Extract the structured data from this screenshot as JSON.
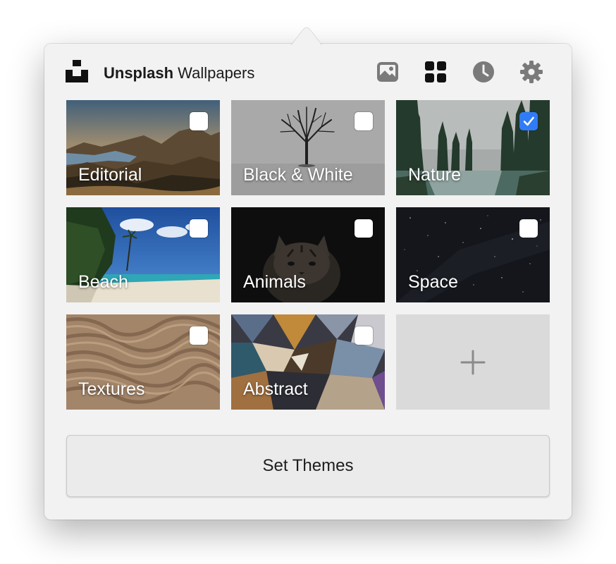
{
  "header": {
    "brand": "Unsplash",
    "title_suffix": " Wallpapers",
    "icons": [
      "image-icon",
      "grid-icon",
      "clock-icon",
      "gear-icon"
    ]
  },
  "categories": [
    {
      "label": "Editorial",
      "checked": false
    },
    {
      "label": "Black & White",
      "checked": false
    },
    {
      "label": "Nature",
      "checked": true
    },
    {
      "label": "Beach",
      "checked": false
    },
    {
      "label": "Animals",
      "checked": false
    },
    {
      "label": "Space",
      "checked": false
    },
    {
      "label": "Textures",
      "checked": false
    },
    {
      "label": "Abstract",
      "checked": false
    }
  ],
  "add_tile": {
    "icon": "plus-icon"
  },
  "set_themes_label": "Set Themes",
  "colors": {
    "accent": "#2f7cf6",
    "icon": "#2a2a2a",
    "icon_muted": "#7a7a7a"
  }
}
